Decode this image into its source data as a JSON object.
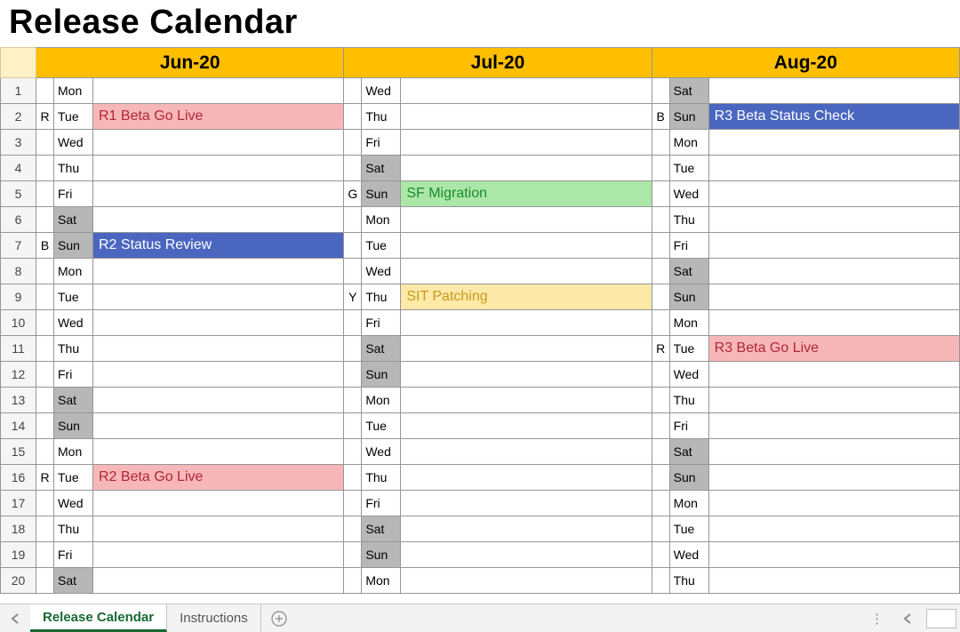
{
  "title": "Release Calendar",
  "months": {
    "jun": "Jun-20",
    "jul": "Jul-20",
    "aug": "Aug-20"
  },
  "rows": [
    {
      "n": 1,
      "jun": {
        "m": "",
        "d": "Mon",
        "wk": false,
        "ev": "",
        "ec": ""
      },
      "jul": {
        "m": "",
        "d": "Wed",
        "wk": false,
        "ev": "",
        "ec": ""
      },
      "aug": {
        "m": "",
        "d": "Sat",
        "wk": true,
        "ev": "",
        "ec": ""
      }
    },
    {
      "n": 2,
      "jun": {
        "m": "R",
        "d": "Tue",
        "wk": false,
        "ev": "R1 Beta Go Live",
        "ec": "red"
      },
      "jul": {
        "m": "",
        "d": "Thu",
        "wk": false,
        "ev": "",
        "ec": ""
      },
      "aug": {
        "m": "B",
        "d": "Sun",
        "wk": true,
        "ev": "R3 Beta Status Check",
        "ec": "blue"
      }
    },
    {
      "n": 3,
      "jun": {
        "m": "",
        "d": "Wed",
        "wk": false,
        "ev": "",
        "ec": ""
      },
      "jul": {
        "m": "",
        "d": "Fri",
        "wk": false,
        "ev": "",
        "ec": ""
      },
      "aug": {
        "m": "",
        "d": "Mon",
        "wk": false,
        "ev": "",
        "ec": ""
      }
    },
    {
      "n": 4,
      "jun": {
        "m": "",
        "d": "Thu",
        "wk": false,
        "ev": "",
        "ec": ""
      },
      "jul": {
        "m": "",
        "d": "Sat",
        "wk": true,
        "ev": "",
        "ec": ""
      },
      "aug": {
        "m": "",
        "d": "Tue",
        "wk": false,
        "ev": "",
        "ec": ""
      }
    },
    {
      "n": 5,
      "jun": {
        "m": "",
        "d": "Fri",
        "wk": false,
        "ev": "",
        "ec": ""
      },
      "jul": {
        "m": "G",
        "d": "Sun",
        "wk": true,
        "ev": "SF Migration",
        "ec": "green"
      },
      "aug": {
        "m": "",
        "d": "Wed",
        "wk": false,
        "ev": "",
        "ec": ""
      }
    },
    {
      "n": 6,
      "jun": {
        "m": "",
        "d": "Sat",
        "wk": true,
        "ev": "",
        "ec": ""
      },
      "jul": {
        "m": "",
        "d": "Mon",
        "wk": false,
        "ev": "",
        "ec": ""
      },
      "aug": {
        "m": "",
        "d": "Thu",
        "wk": false,
        "ev": "",
        "ec": ""
      }
    },
    {
      "n": 7,
      "jun": {
        "m": "B",
        "d": "Sun",
        "wk": true,
        "ev": "R2 Status Review",
        "ec": "blue"
      },
      "jul": {
        "m": "",
        "d": "Tue",
        "wk": false,
        "ev": "",
        "ec": ""
      },
      "aug": {
        "m": "",
        "d": "Fri",
        "wk": false,
        "ev": "",
        "ec": ""
      }
    },
    {
      "n": 8,
      "jun": {
        "m": "",
        "d": "Mon",
        "wk": false,
        "ev": "",
        "ec": ""
      },
      "jul": {
        "m": "",
        "d": "Wed",
        "wk": false,
        "ev": "",
        "ec": ""
      },
      "aug": {
        "m": "",
        "d": "Sat",
        "wk": true,
        "ev": "",
        "ec": ""
      }
    },
    {
      "n": 9,
      "jun": {
        "m": "",
        "d": "Tue",
        "wk": false,
        "ev": "",
        "ec": ""
      },
      "jul": {
        "m": "Y",
        "d": "Thu",
        "wk": false,
        "ev": "SIT Patching",
        "ec": "yellow"
      },
      "aug": {
        "m": "",
        "d": "Sun",
        "wk": true,
        "ev": "",
        "ec": ""
      }
    },
    {
      "n": 10,
      "jun": {
        "m": "",
        "d": "Wed",
        "wk": false,
        "ev": "",
        "ec": ""
      },
      "jul": {
        "m": "",
        "d": "Fri",
        "wk": false,
        "ev": "",
        "ec": ""
      },
      "aug": {
        "m": "",
        "d": "Mon",
        "wk": false,
        "ev": "",
        "ec": ""
      }
    },
    {
      "n": 11,
      "jun": {
        "m": "",
        "d": "Thu",
        "wk": false,
        "ev": "",
        "ec": ""
      },
      "jul": {
        "m": "",
        "d": "Sat",
        "wk": true,
        "ev": "",
        "ec": ""
      },
      "aug": {
        "m": "R",
        "d": "Tue",
        "wk": false,
        "ev": "R3 Beta Go Live",
        "ec": "red"
      }
    },
    {
      "n": 12,
      "jun": {
        "m": "",
        "d": "Fri",
        "wk": false,
        "ev": "",
        "ec": ""
      },
      "jul": {
        "m": "",
        "d": "Sun",
        "wk": true,
        "ev": "",
        "ec": ""
      },
      "aug": {
        "m": "",
        "d": "Wed",
        "wk": false,
        "ev": "",
        "ec": ""
      }
    },
    {
      "n": 13,
      "jun": {
        "m": "",
        "d": "Sat",
        "wk": true,
        "ev": "",
        "ec": ""
      },
      "jul": {
        "m": "",
        "d": "Mon",
        "wk": false,
        "ev": "",
        "ec": ""
      },
      "aug": {
        "m": "",
        "d": "Thu",
        "wk": false,
        "ev": "",
        "ec": ""
      }
    },
    {
      "n": 14,
      "jun": {
        "m": "",
        "d": "Sun",
        "wk": true,
        "ev": "",
        "ec": ""
      },
      "jul": {
        "m": "",
        "d": "Tue",
        "wk": false,
        "ev": "",
        "ec": ""
      },
      "aug": {
        "m": "",
        "d": "Fri",
        "wk": false,
        "ev": "",
        "ec": ""
      }
    },
    {
      "n": 15,
      "jun": {
        "m": "",
        "d": "Mon",
        "wk": false,
        "ev": "",
        "ec": ""
      },
      "jul": {
        "m": "",
        "d": "Wed",
        "wk": false,
        "ev": "",
        "ec": ""
      },
      "aug": {
        "m": "",
        "d": "Sat",
        "wk": true,
        "ev": "",
        "ec": ""
      }
    },
    {
      "n": 16,
      "jun": {
        "m": "R",
        "d": "Tue",
        "wk": false,
        "ev": "R2 Beta Go Live",
        "ec": "red"
      },
      "jul": {
        "m": "",
        "d": "Thu",
        "wk": false,
        "ev": "",
        "ec": ""
      },
      "aug": {
        "m": "",
        "d": "Sun",
        "wk": true,
        "ev": "",
        "ec": ""
      }
    },
    {
      "n": 17,
      "jun": {
        "m": "",
        "d": "Wed",
        "wk": false,
        "ev": "",
        "ec": ""
      },
      "jul": {
        "m": "",
        "d": "Fri",
        "wk": false,
        "ev": "",
        "ec": ""
      },
      "aug": {
        "m": "",
        "d": "Mon",
        "wk": false,
        "ev": "",
        "ec": ""
      }
    },
    {
      "n": 18,
      "jun": {
        "m": "",
        "d": "Thu",
        "wk": false,
        "ev": "",
        "ec": ""
      },
      "jul": {
        "m": "",
        "d": "Sat",
        "wk": true,
        "ev": "",
        "ec": ""
      },
      "aug": {
        "m": "",
        "d": "Tue",
        "wk": false,
        "ev": "",
        "ec": ""
      }
    },
    {
      "n": 19,
      "jun": {
        "m": "",
        "d": "Fri",
        "wk": false,
        "ev": "",
        "ec": ""
      },
      "jul": {
        "m": "",
        "d": "Sun",
        "wk": true,
        "ev": "",
        "ec": ""
      },
      "aug": {
        "m": "",
        "d": "Wed",
        "wk": false,
        "ev": "",
        "ec": ""
      }
    },
    {
      "n": 20,
      "jun": {
        "m": "",
        "d": "Sat",
        "wk": true,
        "ev": "",
        "ec": ""
      },
      "jul": {
        "m": "",
        "d": "Mon",
        "wk": false,
        "ev": "",
        "ec": ""
      },
      "aug": {
        "m": "",
        "d": "Thu",
        "wk": false,
        "ev": "",
        "ec": ""
      }
    }
  ],
  "tabs": {
    "active": "Release Calendar",
    "items": [
      "Release Calendar",
      "Instructions"
    ]
  }
}
